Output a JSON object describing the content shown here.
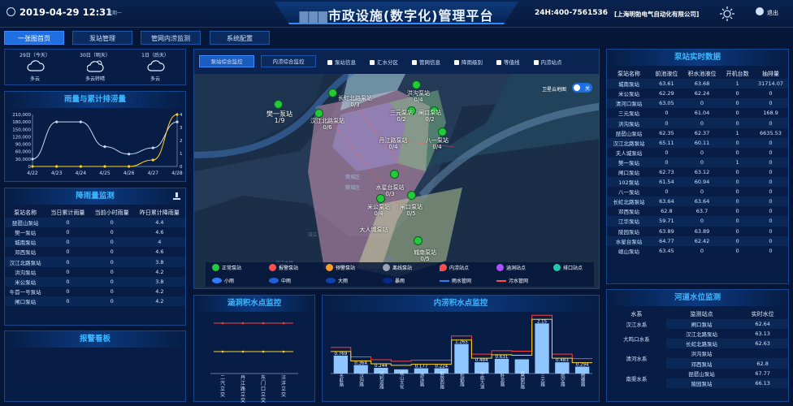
{
  "header": {
    "datetime": "2019-04-29 12:31",
    "weekday": "星期一",
    "title_prefix": "▇▇▇",
    "title": "市政设施(数字化)管理平台",
    "hotline": "24H:400-7561536",
    "company": "[上海明勃电气自动化有限公司]",
    "logout": "退出"
  },
  "nav": [
    "一张图首页",
    "泵站管理",
    "管网内涝监测",
    "系统配置"
  ],
  "weather": [
    {
      "date": "29日（今天）",
      "desc": "多云",
      "icon": "cloud-icon"
    },
    {
      "date": "30日（明天）",
      "desc": "多云转晴",
      "icon": "cloud-sun-icon"
    },
    {
      "date": "1日（后天）",
      "desc": "多云",
      "icon": "cloud-icon"
    }
  ],
  "rainfall": {
    "title": "雨量与累计排涝量",
    "chart_data": {
      "type": "line",
      "categories": [
        "4/22",
        "4/23",
        "4/24",
        "4/25",
        "4/26",
        "4/27",
        "4/28"
      ],
      "series": [
        {
          "values": [
            30000,
            180000,
            180000,
            80000,
            50000,
            75000,
            180000
          ],
          "color": "#c9d8ee"
        },
        {
          "values": [
            0,
            0,
            0,
            0,
            0,
            0.5,
            4
          ],
          "color": "#ffd21f",
          "axis": "right"
        }
      ],
      "y_ticks": [
        "210,000",
        "180,000",
        "150,000",
        "120,000",
        "90,000",
        "60,000",
        "30,000",
        "0"
      ],
      "y2_ticks": [
        "4",
        "3",
        "2",
        "1",
        "0"
      ],
      "ylim": [
        0,
        210000
      ],
      "y2lim": [
        0,
        4
      ]
    }
  },
  "drain": {
    "title": "降雨量监测",
    "headers": [
      "泵站名称",
      "当日累计雨量",
      "当前小时雨量",
      "昨日累计降雨量"
    ],
    "rows": [
      [
        "琵琶山泵站",
        "0",
        "0",
        "4.4"
      ],
      [
        "樊一泵站",
        "0",
        "0",
        "4.6"
      ],
      [
        "城南泵站",
        "0",
        "0",
        "4"
      ],
      [
        "邓西泵站",
        "0",
        "0",
        "4.6"
      ],
      [
        "汉江北路泵站",
        "0",
        "0",
        "3.8"
      ],
      [
        "洪沟泵站",
        "0",
        "0",
        "4.2"
      ],
      [
        "米公泵站",
        "0",
        "0",
        "3.8"
      ],
      [
        "牛首一号泵站",
        "0",
        "0",
        "4.2"
      ],
      [
        "闸口泵站",
        "0",
        "0",
        "4.2"
      ]
    ]
  },
  "alarm": {
    "title": "报警看板"
  },
  "map": {
    "tabs": [
      "泵站综合监控",
      "内涝综合监控"
    ],
    "filters": [
      "泵站信息",
      "汇水分区",
      "管网信息",
      "降雨级别",
      "等值线",
      "内涝站点"
    ],
    "satellite": "卫星云地图",
    "toggle": "关",
    "district": "樊城区",
    "pumps": [
      {
        "name": "长虹北路泵站",
        "val": "0/3"
      },
      {
        "name": "洪沟泵站",
        "val": "0/4"
      },
      {
        "name": "三元泵站",
        "val": "0/2"
      },
      {
        "name": "闸口泵站",
        "val": "0/2"
      },
      {
        "name": "樊一泵站",
        "val": "1/9"
      },
      {
        "name": "汉江北路泵站",
        "val": "0/6"
      },
      {
        "name": "丹江路泵站",
        "val": "0/4"
      },
      {
        "name": "八一泵站",
        "val": "0/4"
      },
      {
        "name": "水星台泵站",
        "val": "0/3"
      },
      {
        "name": "米公泵站",
        "val": "0/4"
      },
      {
        "name": "闸口泵站",
        "val": "0/5"
      },
      {
        "name": "大人城泵站",
        "val": ""
      },
      {
        "name": "城南泵站",
        "val": "0/5"
      }
    ],
    "legend1": [
      "正常泵站",
      "报警泵站",
      "预警泵站",
      "离线泵站",
      "内涝站点",
      "涵洞站点",
      "排口站点"
    ],
    "legend2": [
      "小雨",
      "中雨",
      "大雨",
      "暴雨",
      "雨水管网",
      "污水管网"
    ]
  },
  "culvert": {
    "title": "涵洞积水点监控",
    "categories": [
      "二汽立交",
      "丹江路立交",
      "东门口立交",
      "汪洋立交"
    ]
  },
  "waterlog": {
    "title": "内涝积水点监控",
    "chart_data": {
      "type": "bar",
      "categories": [
        "长虹路",
        "汉沟路",
        "鸿利道路",
        "岘山文化",
        "游泳路",
        "解放西路",
        "松鹤路",
        "中航大道",
        "卧龙路",
        "春园西路",
        "三元路",
        "航空路",
        "鼓楼路"
      ],
      "values": [
        0.769,
        0.364,
        0.244,
        0.177,
        0.224,
        0.224,
        1.265,
        0.484,
        0.631,
        0.61,
        2.15,
        0.483,
        0.294
      ],
      "labels": [
        "0.769",
        "0.364",
        "0.244",
        "",
        "0.177",
        "0.224",
        "1.265",
        "0.484",
        "0.631",
        "",
        "2.15",
        "0.483",
        "0.294"
      ]
    }
  },
  "pumpdata": {
    "title": "泵站实时数据",
    "headers": [
      "泵站名称",
      "前池液位",
      "积水池液位",
      "开机台数",
      "抽排量"
    ],
    "rows": [
      [
        "城南泵站",
        "63.61",
        "63.68",
        "1",
        "31714.07"
      ],
      [
        "米公泵站",
        "62.29",
        "62.24",
        "0",
        "0"
      ],
      [
        "清河口泵站",
        "63.05",
        "0",
        "0",
        "0"
      ],
      [
        "三元泵站",
        "0",
        "61.04",
        "0",
        "168.9"
      ],
      [
        "洪沟泵站",
        "0",
        "0",
        "0",
        "0"
      ],
      [
        "琵琶山泵站",
        "62.35",
        "62.37",
        "1",
        "6635.53"
      ],
      [
        "汉江北路泵站",
        "65.11",
        "60.11",
        "0",
        "0"
      ],
      [
        "夫人城泵站",
        "0",
        "0",
        "0",
        "0"
      ],
      [
        "樊一泵站",
        "0",
        "0",
        "1",
        "0"
      ],
      [
        "闸口泵站",
        "62.73",
        "63.12",
        "0",
        "0"
      ],
      [
        "102泵站",
        "61.54",
        "60.94",
        "0",
        "0"
      ],
      [
        "八一泵站",
        "0",
        "0",
        "0",
        "0"
      ],
      [
        "长虹北路泵站",
        "63.64",
        "63.64",
        "0",
        "0"
      ],
      [
        "邓西泵站",
        "62.8",
        "63.7",
        "0",
        "0"
      ],
      [
        "江华泵站",
        "59.71",
        "0",
        "0",
        "0"
      ],
      [
        "陵园泵站",
        "63.89",
        "63.89",
        "0",
        "0"
      ],
      [
        "水星台泵站",
        "64.77",
        "62.42",
        "0",
        "0"
      ],
      [
        "岘山泵站",
        "63.45",
        "0",
        "0",
        "0"
      ]
    ]
  },
  "waterlevel": {
    "title": "河道水位监测",
    "headers": [
      "水系",
      "监测站点",
      "实时水位"
    ],
    "groups": [
      {
        "sys": "汉江水系",
        "rows": [
          [
            "闸口泵站",
            "62.64"
          ]
        ]
      },
      {
        "sys": "大鸣口水系",
        "rows": [
          [
            "汉江北路泵站",
            "63.13"
          ],
          [
            "长虹北路泵站",
            "62.63"
          ]
        ]
      },
      {
        "sys": "清河水系",
        "rows": [
          [
            "洪沟泵站",
            ""
          ],
          [
            "邓西泵站",
            "62.8"
          ]
        ]
      },
      {
        "sys": "南渠水系",
        "rows": [
          [
            "琵琶山泵站",
            "67.77"
          ],
          [
            "陵园泵站",
            "66.13"
          ]
        ]
      }
    ]
  }
}
